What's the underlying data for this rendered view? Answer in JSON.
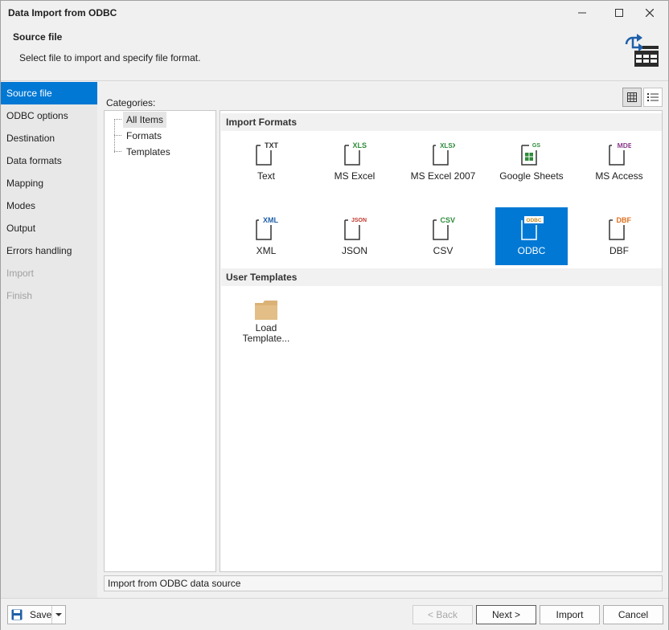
{
  "window": {
    "title": "Data Import from ODBC"
  },
  "header": {
    "step_title": "Source file",
    "step_description": "Select file to import and specify file format."
  },
  "nav": {
    "items": [
      {
        "label": "Source file",
        "state": "active"
      },
      {
        "label": "ODBC options",
        "state": "enabled"
      },
      {
        "label": "Destination",
        "state": "enabled"
      },
      {
        "label": "Data formats",
        "state": "enabled"
      },
      {
        "label": "Mapping",
        "state": "enabled"
      },
      {
        "label": "Modes",
        "state": "enabled"
      },
      {
        "label": "Output",
        "state": "enabled"
      },
      {
        "label": "Errors handling",
        "state": "enabled"
      },
      {
        "label": "Import",
        "state": "disabled"
      },
      {
        "label": "Finish",
        "state": "disabled"
      }
    ]
  },
  "categories": {
    "label": "Categories:",
    "items": [
      "All Items",
      "Formats",
      "Templates"
    ],
    "selected": "All Items"
  },
  "gallery": {
    "import_formats_header": "Import Formats",
    "formats": [
      {
        "label": "Text",
        "tag": "TXT",
        "color": "#333333"
      },
      {
        "label": "MS Excel",
        "tag": "XLS",
        "color": "#2e8b3a"
      },
      {
        "label": "MS Excel 2007",
        "tag": "XLSX",
        "color": "#2e8b3a"
      },
      {
        "label": "Google Sheets",
        "tag": "GS",
        "color": "#2e8b3a"
      },
      {
        "label": "MS Access",
        "tag": "MDB",
        "color": "#8b3a8b"
      },
      {
        "label": "XML",
        "tag": "XML",
        "color": "#1f5fa8"
      },
      {
        "label": "JSON",
        "tag": "JSON",
        "color": "#c0392b"
      },
      {
        "label": "CSV",
        "tag": "CSV",
        "color": "#2e8b3a"
      },
      {
        "label": "ODBC",
        "tag": "ODBC",
        "color": "#ffffff"
      },
      {
        "label": "DBF",
        "tag": "DBF",
        "color": "#e07020"
      }
    ],
    "selected_format": "ODBC",
    "user_templates_header": "User Templates",
    "templates": [
      {
        "label_line1": "Load",
        "label_line2": "Template..."
      }
    ]
  },
  "status": {
    "text": "Import from ODBC data source"
  },
  "footer": {
    "save": "Save",
    "back": "< Back",
    "next": "Next >",
    "import": "Import",
    "cancel": "Cancel"
  },
  "colors": {
    "accent": "#0078d4"
  }
}
